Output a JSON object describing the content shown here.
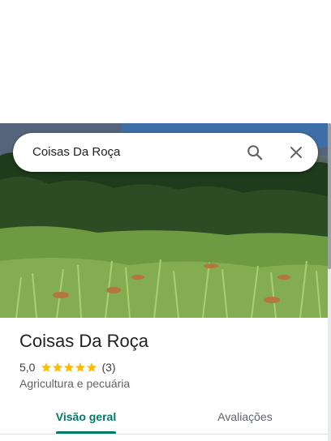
{
  "search": {
    "query": "Coisas Da Roça",
    "search_icon": "search-icon",
    "close_icon": "close-icon"
  },
  "photo": {
    "icon": "landscape-photo"
  },
  "place": {
    "name": "Coisas Da Roça",
    "rating": "5,0",
    "rating_value": 5.0,
    "stars_max": 5,
    "review_count": "(3)",
    "category": "Agricultura e pecuária"
  },
  "tabs": [
    {
      "label": "Visão geral",
      "selected": true
    },
    {
      "label": "Avaliações",
      "selected": false
    }
  ],
  "colors": {
    "accent": "#00796b",
    "star": "#fbbc04",
    "text_primary": "#202124",
    "text_secondary": "#5f6368"
  }
}
